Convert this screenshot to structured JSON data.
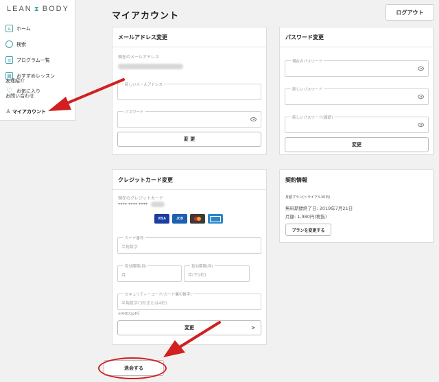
{
  "brand": {
    "logo_left": "LEAN",
    "logo_right": "BODY",
    "accent": "#4aa3a9",
    "annotation_red": "#d21f1f"
  },
  "sidebar": {
    "items": [
      {
        "label": "ホーム",
        "icon": "home-icon"
      },
      {
        "label": "検索",
        "icon": "search-icon"
      },
      {
        "label": "プログラム一覧",
        "icon": "list-icon"
      },
      {
        "label": "おすすめレッスン",
        "icon": "calendar-icon"
      },
      {
        "label": "お気に入り",
        "icon": "heart-icon"
      },
      {
        "label": "マイアカウント",
        "icon": "user-icon"
      }
    ],
    "overlap_1": "友達紹介",
    "overlap_2": "お問い合わせ"
  },
  "header": {
    "title": "マイアカウント",
    "logout_label": "ログアウト"
  },
  "email_panel": {
    "title": "メールアドレス変更",
    "current_label": "現在のメールアドレス",
    "new_email_label": "新しいメールアドレス",
    "password_label": "パスワード",
    "submit_label": "変 更"
  },
  "password_panel": {
    "title": "パスワード変更",
    "current_label": "現在のパスワード",
    "new_label": "新しいパスワード",
    "confirm_label": "新しいパスワード(確認)",
    "submit_label": "変更"
  },
  "card_panel": {
    "title": "クレジットカード変更",
    "current_label": "現在のクレジットカード",
    "masked_number": "**** **** ****",
    "brands": [
      {
        "label": "VISA",
        "color": "#1a3fa0"
      },
      {
        "label": "JCB",
        "color": "#1d5fb0"
      },
      {
        "label": "MC",
        "color": "#3a3a3a"
      },
      {
        "label": "AMEX",
        "color": "#2e86c8"
      }
    ],
    "card_number_label": "カード番号",
    "card_number_placeholder": "半角数字",
    "exp_month_label": "有効期限(月)",
    "exp_month_placeholder": "月",
    "exp_year_label": "有効期限(年)",
    "exp_year_placeholder": "年(下2桁)",
    "security_label": "セキュリティーコード(カード裏の数字)",
    "security_placeholder": "半角数字(3桁または4桁)",
    "security_note": "※AMEXは4桁",
    "submit_label": "変更",
    "submit_chevron": ">"
  },
  "contract_panel": {
    "title": "契約情報",
    "plan_line": "月額プラン(トライアル30日)",
    "trial_end": "無料期間終了日: 2019年7月21日",
    "monthly": "月額: 1,980円(税抜)",
    "change_plan_label": "プランを変更する"
  },
  "withdraw": {
    "label": "退会する"
  }
}
